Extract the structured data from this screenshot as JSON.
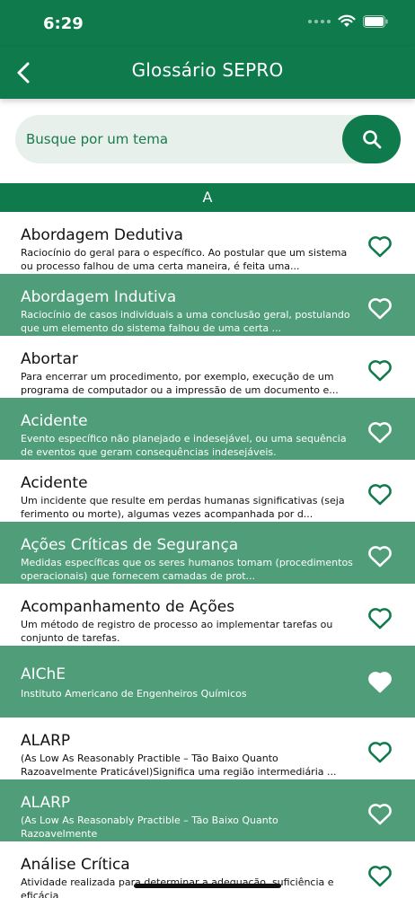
{
  "status": {
    "time": "6:29"
  },
  "header": {
    "title": "Glossário SEPRO"
  },
  "search": {
    "placeholder": "Busque por um tema"
  },
  "section": {
    "letter": "A"
  },
  "colors": {
    "brand": "#0f7a4b",
    "row_alt": "#4f9e79",
    "search_bg": "#e7f0ea"
  },
  "items": [
    {
      "title": "Abordagem Dedutiva",
      "description": "Raciocínio do geral para o específico. Ao postular que um sistema ou processo falhou de uma certa maneira, é feita uma...",
      "favorite": false
    },
    {
      "title": "Abordagem Indutiva",
      "description": "Raciocínio de casos individuais a uma conclusão geral, postulando que um elemento do sistema falhou de uma certa ...",
      "favorite": false
    },
    {
      "title": "Abortar",
      "description": "Para encerrar um procedimento, por exemplo, execução de um programa de computador ou a impressão de um documento e...",
      "favorite": false
    },
    {
      "title": "Acidente",
      "description": "Evento específico não planejado e indesejável, ou uma sequência de eventos que geram consequências indesejáveis.",
      "favorite": false
    },
    {
      "title": "Acidente",
      "description": "Um incidente que resulte em perdas humanas significativas (seja ferimento ou morte), algumas vezes acompanhada por d...",
      "favorite": false
    },
    {
      "title": "Ações Críticas de Segurança",
      "description": "Medidas específicas que os seres humanos tomam (procedimentos operacionais) que fornecem camadas de prot...",
      "favorite": false
    },
    {
      "title": "Acompanhamento de Ações",
      "description": "Um método de registro de processo ao implementar tarefas ou conjunto de tarefas.",
      "favorite": false
    },
    {
      "title": "AIChE",
      "description": "Instituto Americano de Engenheiros Químicos",
      "favorite": true
    },
    {
      "title": "ALARP",
      "description": "(As Low As Reasonably Practible – Tão Baixo Quanto Razoavelmente Praticável)Significa uma região intermediária ...",
      "favorite": false
    },
    {
      "title": "ALARP",
      "description": "(As Low As Reasonably Practible – Tão Baixo Quanto Razoavelmente",
      "favorite": false
    },
    {
      "title": "Análise Crítica",
      "description": "Atividade realizada para determinar a adequação, suficiência e eficácia",
      "favorite": false
    }
  ]
}
